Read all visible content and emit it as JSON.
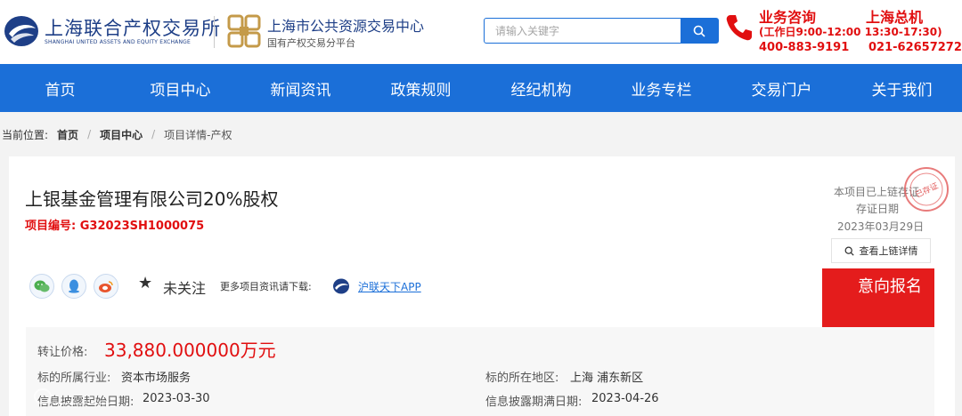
{
  "header": {
    "logo1": {
      "cn": "上海联合产权交易所",
      "en": "SHANGHAI UNITED ASSETS AND EQUITY EXCHANGE"
    },
    "logo2": {
      "title": "上海市公共资源交易中心",
      "subtitle": "国有产权交易分平台"
    },
    "search": {
      "placeholder": "请输入关键字",
      "icon": "search-icon"
    },
    "hotline1": {
      "title": "业务咨询",
      "hours": "(工作日9:00-12:00 13:30-17:30)",
      "number": "400-883-9191"
    },
    "hotline2": {
      "title": "上海总机",
      "number": "021-62657272"
    },
    "accent": "#e10f10",
    "brand": "#1b6fd8"
  },
  "nav": {
    "items": [
      {
        "label": "首页"
      },
      {
        "label": "项目中心"
      },
      {
        "label": "新闻资讯"
      },
      {
        "label": "政策规则"
      },
      {
        "label": "经纪机构"
      },
      {
        "label": "业务专栏"
      },
      {
        "label": "交易门户"
      },
      {
        "label": "关于我们"
      }
    ]
  },
  "breadcrumb": {
    "label": "当前位置:",
    "items": [
      "首页",
      "项目中心"
    ],
    "current": "项目详情-产权"
  },
  "project": {
    "title": "上银基金管理有限公司20%股权",
    "code_label": "项目编号:",
    "code": "G32023SH1000075",
    "chain": {
      "line1": "本项目已上链存证",
      "line2": "存证日期",
      "date": "2023年03月29日",
      "stamp_text": "已存证",
      "button": "查看上链详情"
    },
    "follow": "未关注",
    "download_text": "更多项目资讯请下载:",
    "app_link": "沪联天下APP",
    "apply": "意向报名"
  },
  "info": {
    "price_label": "转让价格:",
    "price_value": "33,880.000000万元",
    "rows": [
      {
        "label": "标的所属行业:",
        "value": "资本市场服务"
      },
      {
        "label": "标的所在地区:",
        "value": "上海 浦东新区"
      },
      {
        "label": "信息披露起始日期:",
        "value": "2023-03-30"
      },
      {
        "label": "信息披露期满日期:",
        "value": "2023-04-26"
      }
    ]
  }
}
